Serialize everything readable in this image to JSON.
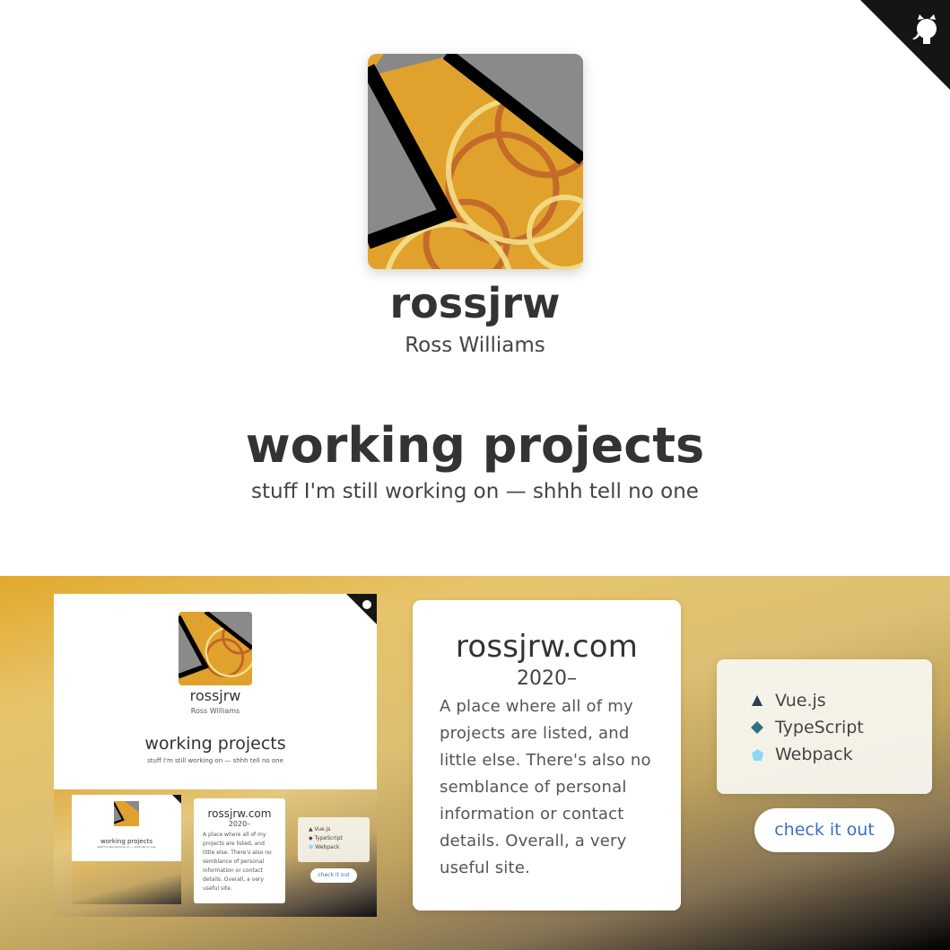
{
  "profile": {
    "handle": "rossjrw",
    "name": "Ross Williams"
  },
  "section": {
    "title": "working projects",
    "subtitle": "stuff I'm still working on — shhh tell no one"
  },
  "project": {
    "title": "rossjrw.com",
    "years": "2020–",
    "description": "A place where all of my projects are listed, and little else. There's also no semblance of personal information or contact details. Overall, a very useful site.",
    "tech": [
      {
        "label": "Vue.js",
        "icon": "triangle-icon",
        "color": "#2c3e50"
      },
      {
        "label": "TypeScript",
        "icon": "diamond-icon",
        "color": "#2f6f8a"
      },
      {
        "label": "Webpack",
        "icon": "pentagon-icon",
        "color": "#8ed6fb"
      }
    ],
    "cta": "check it out"
  },
  "colors": {
    "avatar_gold": "#e0a22c",
    "avatar_gray": "#8a8a8a",
    "link": "#3a6fc4",
    "corner": "#151513"
  }
}
